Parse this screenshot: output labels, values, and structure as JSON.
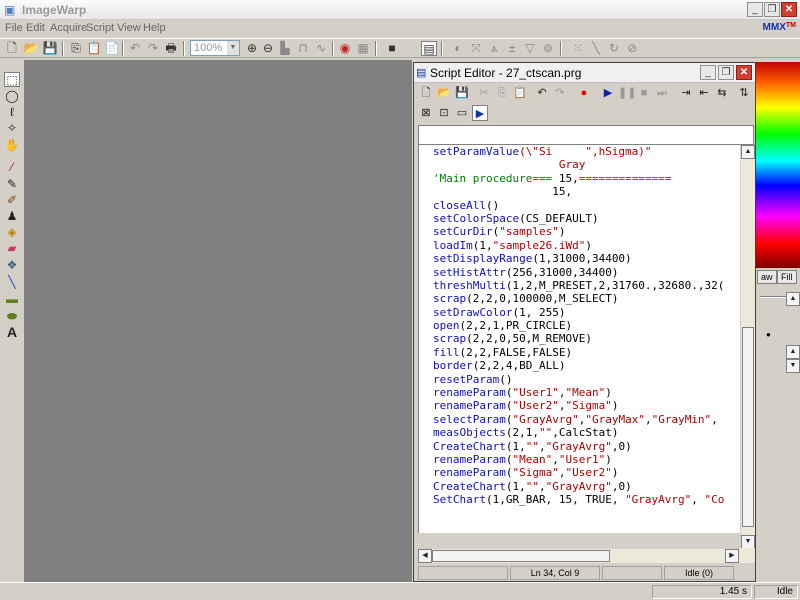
{
  "app": {
    "title": "ImageWarp",
    "badge": "MMX",
    "badge_suffix": "TM"
  },
  "window_controls": {
    "minimize": "_",
    "restore": "❐",
    "close": "✕"
  },
  "menu": [
    "File",
    "Edit",
    "Acquire",
    "Script",
    "View",
    "Help"
  ],
  "toolbar": {
    "zoom_value": "100%"
  },
  "right_panel": {
    "tab1": "aw",
    "tab2": "Fill"
  },
  "status": {
    "time": "1.45 s",
    "state": "Idle"
  },
  "editor": {
    "title": "Script Editor - 27_ctscan.prg",
    "status_pos": "Ln 34, Col 9",
    "status_state": "Idle",
    "status_count": "(0)",
    "lines": [
      [
        {
          "t": "setParamValue",
          "c": "fn"
        },
        {
          "t": "(\\\"Si     \",hSigma)\"",
          "c": "str"
        }
      ],
      [
        {
          "t": "                   Gray",
          "c": "str"
        }
      ],
      [
        {
          "t": "'Main procedure=== ",
          "c": "cm"
        },
        {
          "t": "15,",
          "c": "pl"
        },
        {
          "t": "==============",
          "c": "cm"
        }
      ],
      [
        {
          "t": "                  15,",
          "c": "pl"
        }
      ],
      [
        {
          "t": "closeAll",
          "c": "fn"
        },
        {
          "t": "()",
          "c": "pl"
        }
      ],
      [
        {
          "t": "setColorSpace",
          "c": "fn"
        },
        {
          "t": "(CS_DEFAULT)",
          "c": "pl"
        }
      ],
      [
        {
          "t": "setCurDir",
          "c": "fn"
        },
        {
          "t": "(",
          "c": "pl"
        },
        {
          "t": "\"samples\"",
          "c": "str"
        },
        {
          "t": ")",
          "c": "pl"
        }
      ],
      [
        {
          "t": "loadIm",
          "c": "fn"
        },
        {
          "t": "(1,",
          "c": "pl"
        },
        {
          "t": "\"sample26.iWd\"",
          "c": "str"
        },
        {
          "t": ")",
          "c": "pl"
        }
      ],
      [
        {
          "t": "setDisplayRange",
          "c": "fn"
        },
        {
          "t": "(1,31000,34400)",
          "c": "pl"
        }
      ],
      [
        {
          "t": "setHistAttr",
          "c": "fn"
        },
        {
          "t": "(256,31000,34400)",
          "c": "pl"
        }
      ],
      [
        {
          "t": "threshMulti",
          "c": "fn"
        },
        {
          "t": "(1,2,M_PRESET,2,31760.,32680.,32(",
          "c": "pl"
        }
      ],
      [
        {
          "t": "scrap",
          "c": "fn"
        },
        {
          "t": "(2,2,0,100000,M_SELECT)",
          "c": "pl"
        }
      ],
      [
        {
          "t": "setDrawColor",
          "c": "fn"
        },
        {
          "t": "(1, 255)",
          "c": "pl"
        }
      ],
      [
        {
          "t": "open",
          "c": "fn"
        },
        {
          "t": "(2,2,1,PR_CIRCLE)",
          "c": "pl"
        }
      ],
      [
        {
          "t": "scrap",
          "c": "fn"
        },
        {
          "t": "(2,2,0,50,M_REMOVE)",
          "c": "pl"
        }
      ],
      [
        {
          "t": "fill",
          "c": "fn"
        },
        {
          "t": "(2,2,FALSE,FALSE)",
          "c": "pl"
        }
      ],
      [
        {
          "t": "border",
          "c": "fn"
        },
        {
          "t": "(2,2,4,BD_ALL)",
          "c": "pl"
        }
      ],
      [
        {
          "t": "resetParam",
          "c": "fn"
        },
        {
          "t": "()",
          "c": "pl"
        }
      ],
      [
        {
          "t": "renameParam",
          "c": "fn"
        },
        {
          "t": "(",
          "c": "pl"
        },
        {
          "t": "\"User1\"",
          "c": "str"
        },
        {
          "t": ",",
          "c": "pl"
        },
        {
          "t": "\"Mean\"",
          "c": "str"
        },
        {
          "t": ")",
          "c": "pl"
        }
      ],
      [
        {
          "t": "renameParam",
          "c": "fn"
        },
        {
          "t": "(",
          "c": "pl"
        },
        {
          "t": "\"User2\"",
          "c": "str"
        },
        {
          "t": ",",
          "c": "pl"
        },
        {
          "t": "\"Sigma\"",
          "c": "str"
        },
        {
          "t": ")",
          "c": "pl"
        }
      ],
      [
        {
          "t": "selectParam",
          "c": "fn"
        },
        {
          "t": "(",
          "c": "pl"
        },
        {
          "t": "\"GrayAvrg\"",
          "c": "str"
        },
        {
          "t": ",",
          "c": "pl"
        },
        {
          "t": "\"GrayMax\"",
          "c": "str"
        },
        {
          "t": ",",
          "c": "pl"
        },
        {
          "t": "\"GrayMin\"",
          "c": "str"
        },
        {
          "t": ",",
          "c": "pl"
        }
      ],
      [
        {
          "t": "measObjects",
          "c": "fn"
        },
        {
          "t": "(2,1,",
          "c": "pl"
        },
        {
          "t": "\"\"",
          "c": "str"
        },
        {
          "t": ",CalcStat)",
          "c": "pl"
        }
      ],
      [
        {
          "t": "CreateChart",
          "c": "fn"
        },
        {
          "t": "(1,",
          "c": "pl"
        },
        {
          "t": "\"\"",
          "c": "str"
        },
        {
          "t": ",",
          "c": "pl"
        },
        {
          "t": "\"GrayAvrg\"",
          "c": "str"
        },
        {
          "t": ",0)",
          "c": "pl"
        }
      ],
      [
        {
          "t": "renameParam",
          "c": "fn"
        },
        {
          "t": "(",
          "c": "pl"
        },
        {
          "t": "\"Mean\"",
          "c": "str"
        },
        {
          "t": ",",
          "c": "pl"
        },
        {
          "t": "\"User1\"",
          "c": "str"
        },
        {
          "t": ")",
          "c": "pl"
        }
      ],
      [
        {
          "t": "renameParam",
          "c": "fn"
        },
        {
          "t": "(",
          "c": "pl"
        },
        {
          "t": "\"Sigma\"",
          "c": "str"
        },
        {
          "t": ",",
          "c": "pl"
        },
        {
          "t": "\"User2\"",
          "c": "str"
        },
        {
          "t": ")",
          "c": "pl"
        }
      ],
      [
        {
          "t": "CreateChart",
          "c": "fn"
        },
        {
          "t": "(1,",
          "c": "pl"
        },
        {
          "t": "\"\"",
          "c": "str"
        },
        {
          "t": ",",
          "c": "pl"
        },
        {
          "t": "\"GrayAvrg\"",
          "c": "str"
        },
        {
          "t": ",0)",
          "c": "pl"
        }
      ],
      [
        {
          "t": "SetChart",
          "c": "fn"
        },
        {
          "t": "(1,GR_BAR, 15, TRUE, ",
          "c": "pl"
        },
        {
          "t": "\"GrayAvrg\"",
          "c": "str"
        },
        {
          "t": ", ",
          "c": "pl"
        },
        {
          "t": "\"Co",
          "c": "str"
        }
      ]
    ]
  }
}
